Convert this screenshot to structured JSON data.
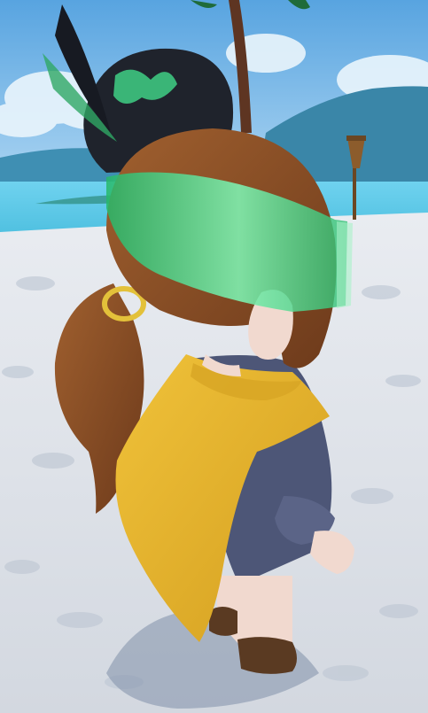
{
  "scene": {
    "description_colors": {
      "sky_top": "#58a4e0",
      "sky_bottom": "#bfe0f6",
      "sea": "#5fc8e6",
      "island": "#3f8fb3",
      "sand": "#dfe3ea",
      "sand_shadow": "#bcc5d2",
      "hair": "#8a4b24",
      "cape": "#e8b52a",
      "robe": "#4d5677",
      "visor": "#3edc8a",
      "hat": "#1f232c",
      "skin": "#f1d9cf",
      "boot": "#5a3a22",
      "hair_tie": "#e3c13a",
      "tiki_torch": "#7a5228"
    },
    "hud": {}
  }
}
